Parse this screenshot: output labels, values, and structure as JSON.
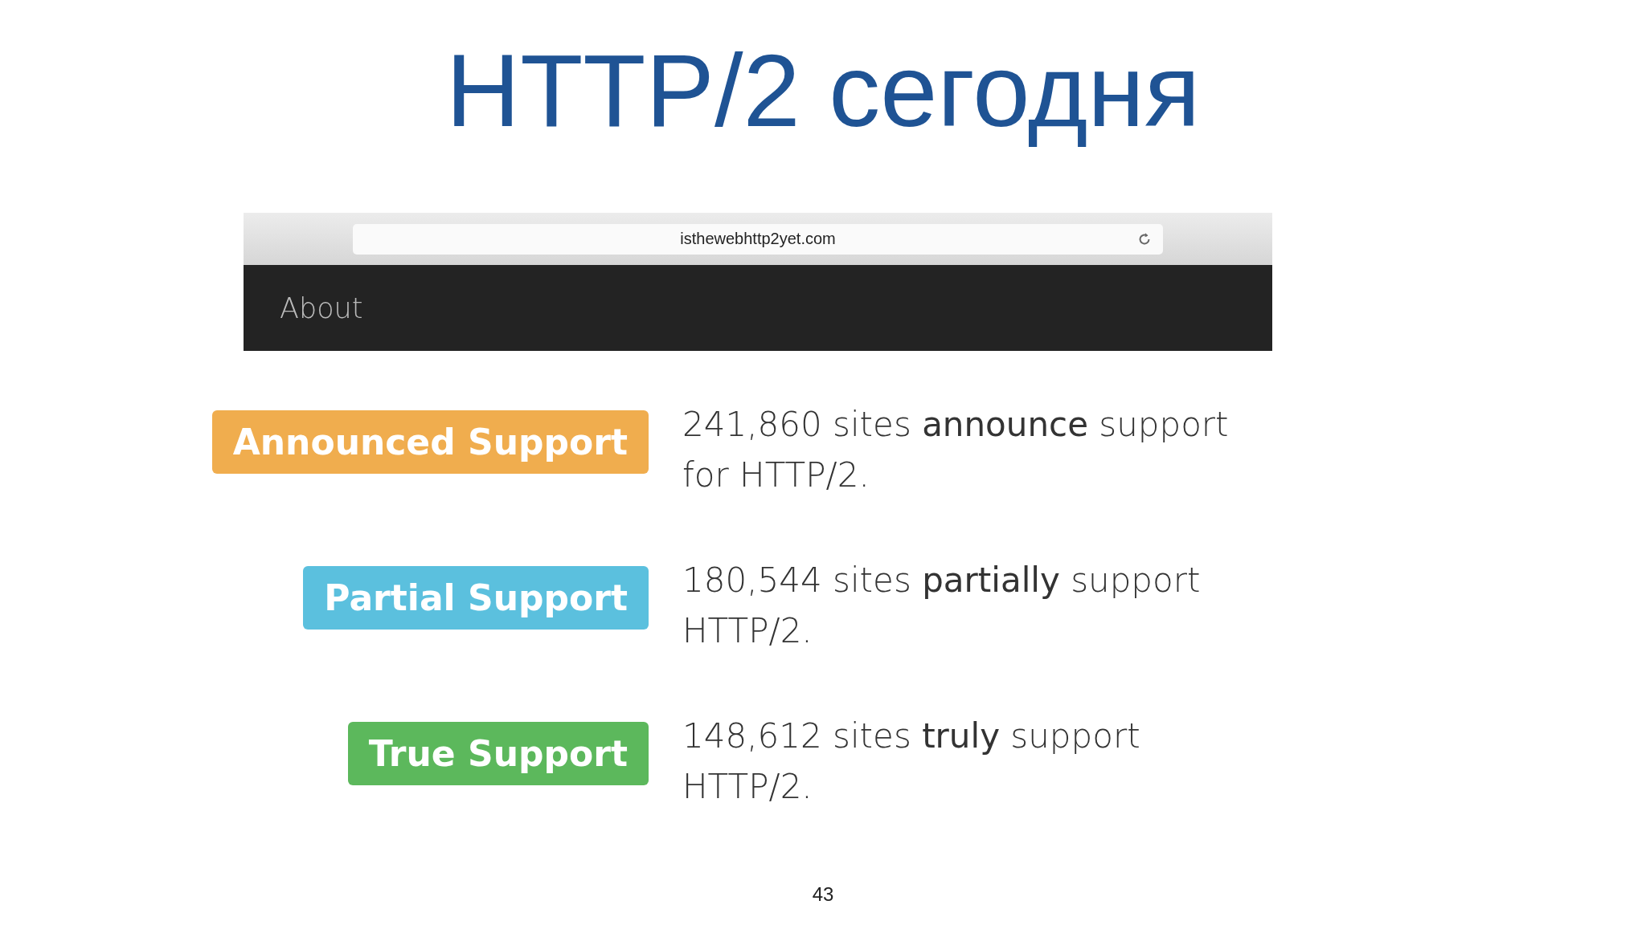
{
  "title": "HTTP/2 сегодня",
  "browser": {
    "url": "isthewebhttp2yet.com",
    "nav_item": "About"
  },
  "rows": [
    {
      "kind": "announced",
      "label": "Announced Support",
      "text": "241,860 sites **announce** support for HTTP/2."
    },
    {
      "kind": "partial",
      "label": "Partial Support",
      "text": "180,544 sites **partially** support HTTP/2."
    },
    {
      "kind": "true",
      "label": "True Support",
      "text": "148,612 sites **truly** support HTTP/2."
    }
  ],
  "page_number": "43"
}
